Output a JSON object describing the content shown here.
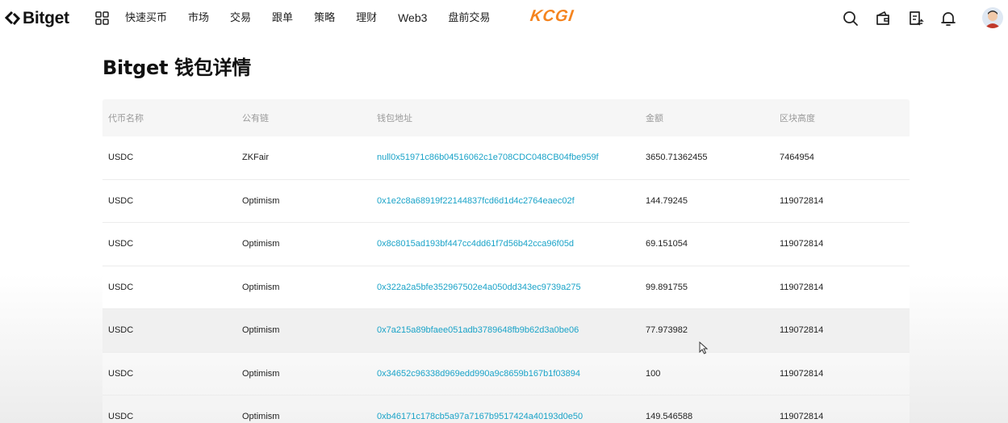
{
  "header": {
    "logo": "Bitget",
    "nav": [
      "快速买币",
      "市场",
      "交易",
      "跟单",
      "策略",
      "理财",
      "Web3",
      "盘前交易"
    ],
    "promo": "KCGI",
    "icons": [
      "search-icon",
      "wallet-icon",
      "orders-icon",
      "bell-icon"
    ]
  },
  "page": {
    "title": "Bitget 钱包详情"
  },
  "table": {
    "columns": [
      "代币名称",
      "公有链",
      "钱包地址",
      "金额",
      "区块高度"
    ],
    "rows": [
      {
        "token": "USDC",
        "chain": "ZKFair",
        "address": "null0x51971c86b04516062c1e708CDC048CB04fbe959f",
        "amount": "3650.71362455",
        "height": "7464954"
      },
      {
        "token": "USDC",
        "chain": "Optimism",
        "address": "0x1e2c8a68919f22144837fcd6d1d4c2764eaec02f",
        "amount": "144.79245",
        "height": "119072814"
      },
      {
        "token": "USDC",
        "chain": "Optimism",
        "address": "0x8c8015ad193bf447cc4dd61f7d56b42cca96f05d",
        "amount": "69.151054",
        "height": "119072814"
      },
      {
        "token": "USDC",
        "chain": "Optimism",
        "address": "0x322a2a5bfe352967502e4a050dd343ec9739a275",
        "amount": "99.891755",
        "height": "119072814"
      },
      {
        "token": "USDC",
        "chain": "Optimism",
        "address": "0x7a215a89bfaee051adb3789648fb9b62d3a0be06",
        "amount": "77.973982",
        "height": "119072814"
      },
      {
        "token": "USDC",
        "chain": "Optimism",
        "address": "0x34652c96338d969edd990a9c8659b167b1f03894",
        "amount": "100",
        "height": "119072814"
      },
      {
        "token": "USDC",
        "chain": "Optimism",
        "address": "0xb46171c178cb5a97a7167b9517424a40193d0e50",
        "amount": "149.546588",
        "height": "119072814"
      }
    ]
  },
  "colors": {
    "link": "#1aa3c8",
    "promo": "#f5841f",
    "header_text": "#9a9a9a"
  }
}
